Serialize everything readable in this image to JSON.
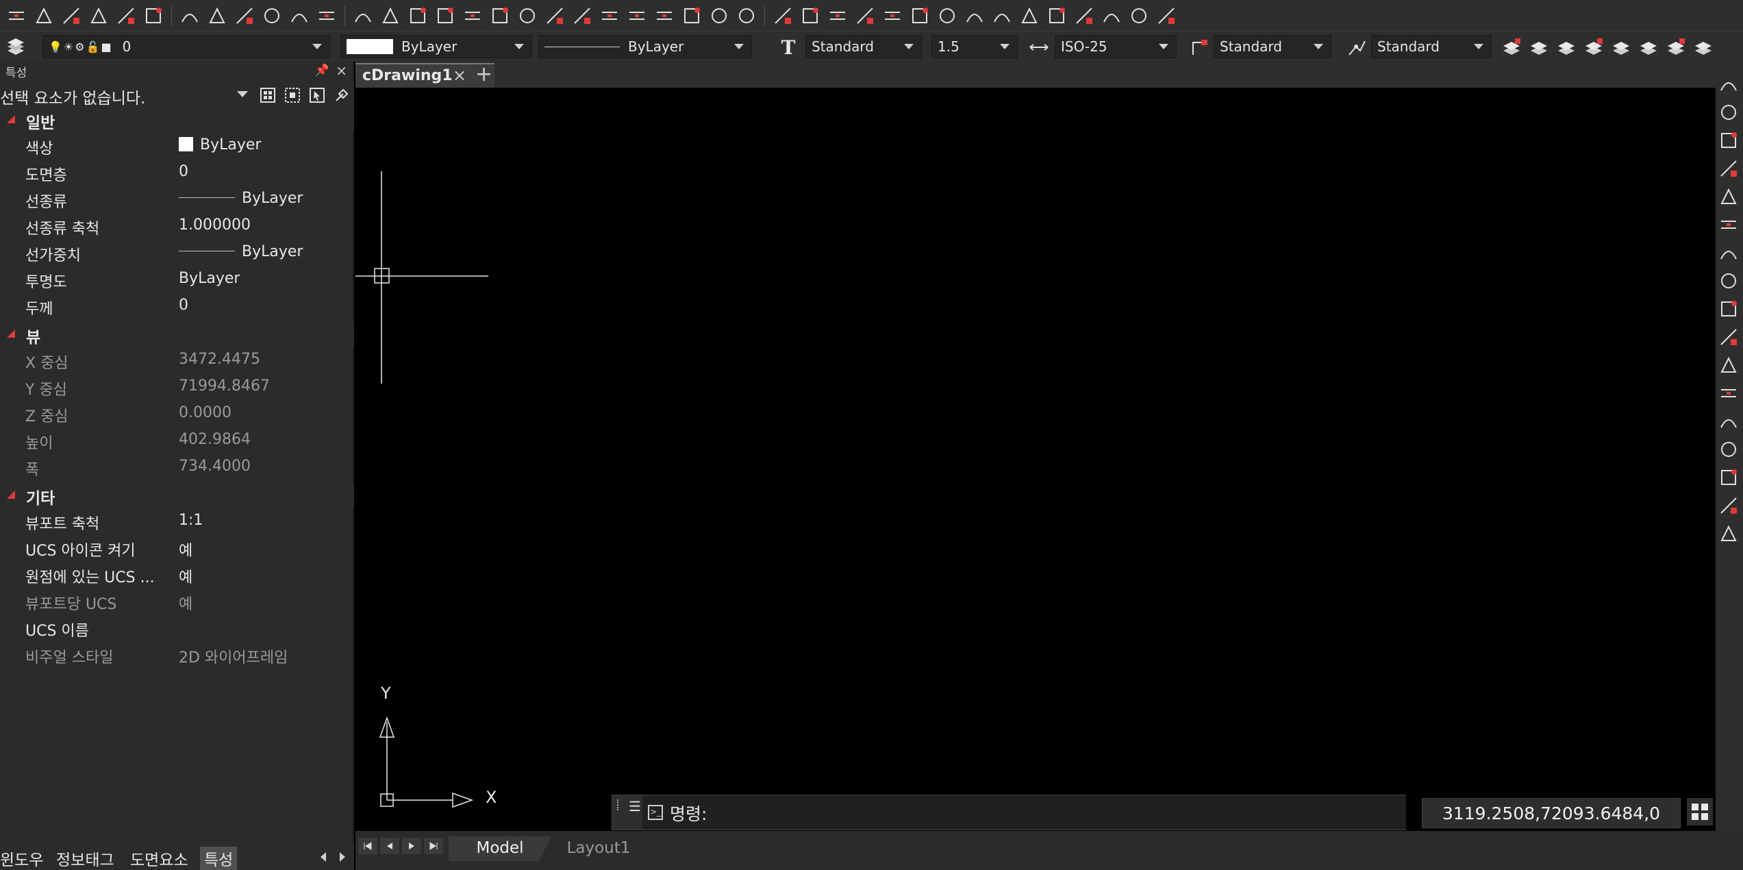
{
  "toolbar": {
    "row1_icons": [
      "xline-icon",
      "mline-icon",
      "pline-icon",
      "ray-icon",
      "construct-icon",
      "multiline-icon",
      "undo-icon",
      "table-icon",
      "block-icon",
      "insert-icon",
      "wblock-icon",
      "attdef-icon",
      "line-icon",
      "dline-icon",
      "spline-icon",
      "hatch-icon",
      "polygon-icon",
      "rectangle-icon",
      "arc-icon",
      "circle-icon",
      "donut-icon",
      "revcloud-icon",
      "ellipse-icon",
      "region-icon",
      "gradient-icon",
      "boundary-icon",
      "wipeout-icon",
      "move-icon",
      "copy-icon",
      "rotate-icon",
      "stretch-icon",
      "trim-icon",
      "extend-icon",
      "mirror-icon",
      "offset-icon",
      "array-icon",
      "fillet-icon",
      "chamfer-icon",
      "break-icon",
      "explode-icon",
      "scale-icon",
      "lengthen-icon"
    ],
    "layer_value": "0",
    "color_value": "ByLayer",
    "linetype_value": "ByLayer",
    "text_style": "Standard",
    "text_height": "1.5",
    "dim_style": "ISO-25",
    "mleader_style": "Standard",
    "table_style": "Standard"
  },
  "palette": {
    "title": "특성",
    "selection": "선택 요소가 없습니다.",
    "sections": {
      "general": {
        "label": "일반",
        "rows": [
          {
            "key": "색상",
            "value": "ByLayer"
          },
          {
            "key": "도면층",
            "value": "0"
          },
          {
            "key": "선종류",
            "value": "ByLayer"
          },
          {
            "key": "선종류 축척",
            "value": "1.000000"
          },
          {
            "key": "선가중치",
            "value": "ByLayer"
          },
          {
            "key": "투명도",
            "value": "ByLayer"
          },
          {
            "key": "두께",
            "value": "0"
          }
        ]
      },
      "view": {
        "label": "뷰",
        "rows": [
          {
            "key": "X 중심",
            "value": "3472.4475"
          },
          {
            "key": "Y 중심",
            "value": "71994.8467"
          },
          {
            "key": "Z 중심",
            "value": "0.0000"
          },
          {
            "key": "높이",
            "value": "402.9864"
          },
          {
            "key": "폭",
            "value": "734.4000"
          }
        ]
      },
      "misc": {
        "label": "기타",
        "rows": [
          {
            "key": "뷰포트 축척",
            "value": "1:1"
          },
          {
            "key": "UCS 아이콘 켜기",
            "value": "예"
          },
          {
            "key": "원점에 있는 UCS ...",
            "value": "예"
          },
          {
            "key": "뷰포트당 UCS",
            "value": "예"
          },
          {
            "key": "UCS 이름",
            "value": ""
          },
          {
            "key": "비주얼 스타일",
            "value": "2D 와이어프레임"
          }
        ]
      }
    },
    "bottom_tabs": [
      "윈도우",
      "정보태그",
      "도면요소",
      "특성"
    ]
  },
  "document": {
    "tab_title": "cDrawing1"
  },
  "ucs": {
    "x_label": "X",
    "y_label": "Y"
  },
  "command": {
    "prompt": "명령:"
  },
  "status": {
    "coordinates": "3119.2508,72093.6484,0"
  },
  "layout_tabs": [
    "Model",
    "Layout1"
  ],
  "colors": {
    "accent_red": "#e03a3a",
    "background": "#000000",
    "panel": "#2b2b2b"
  }
}
